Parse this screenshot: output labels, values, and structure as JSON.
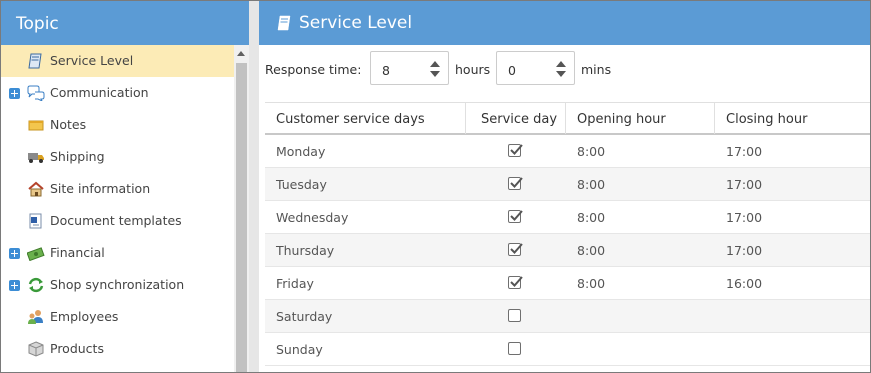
{
  "topic_panel": {
    "title": "Topic",
    "items": [
      {
        "label": "Service Level",
        "icon": "book-icon",
        "selected": true,
        "expandable": false
      },
      {
        "label": "Communication",
        "icon": "speech-bubbles-icon",
        "selected": false,
        "expandable": true
      },
      {
        "label": "Notes",
        "icon": "note-icon",
        "selected": false,
        "expandable": false
      },
      {
        "label": "Shipping",
        "icon": "truck-icon",
        "selected": false,
        "expandable": false
      },
      {
        "label": "Site information",
        "icon": "house-icon",
        "selected": false,
        "expandable": false
      },
      {
        "label": "Document templates",
        "icon": "document-icon",
        "selected": false,
        "expandable": false
      },
      {
        "label": "Financial",
        "icon": "money-icon",
        "selected": false,
        "expandable": true
      },
      {
        "label": "Shop synchronization",
        "icon": "sync-icon",
        "selected": false,
        "expandable": true
      },
      {
        "label": "Employees",
        "icon": "people-icon",
        "selected": false,
        "expandable": false
      },
      {
        "label": "Products",
        "icon": "box-icon",
        "selected": false,
        "expandable": false
      }
    ]
  },
  "service_level": {
    "title": "Service Level",
    "response_time_label": "Response time:",
    "hours_value": "8",
    "hours_unit": "hours",
    "mins_value": "0",
    "mins_unit": "mins",
    "columns": [
      "Customer service days",
      "Service day",
      "Opening hour",
      "Closing hour"
    ],
    "rows": [
      {
        "day": "Monday",
        "service_day": true,
        "opening": "8:00",
        "closing": "17:00"
      },
      {
        "day": "Tuesday",
        "service_day": true,
        "opening": "8:00",
        "closing": "17:00"
      },
      {
        "day": "Wednesday",
        "service_day": true,
        "opening": "8:00",
        "closing": "17:00"
      },
      {
        "day": "Thursday",
        "service_day": true,
        "opening": "8:00",
        "closing": "17:00"
      },
      {
        "day": "Friday",
        "service_day": true,
        "opening": "8:00",
        "closing": "16:00"
      },
      {
        "day": "Saturday",
        "service_day": false,
        "opening": "",
        "closing": ""
      },
      {
        "day": "Sunday",
        "service_day": false,
        "opening": "",
        "closing": ""
      }
    ]
  },
  "colors": {
    "header_blue": "#5b9bd5",
    "selected_row": "#fcebb6",
    "expander_blue": "#3c8dd5"
  }
}
